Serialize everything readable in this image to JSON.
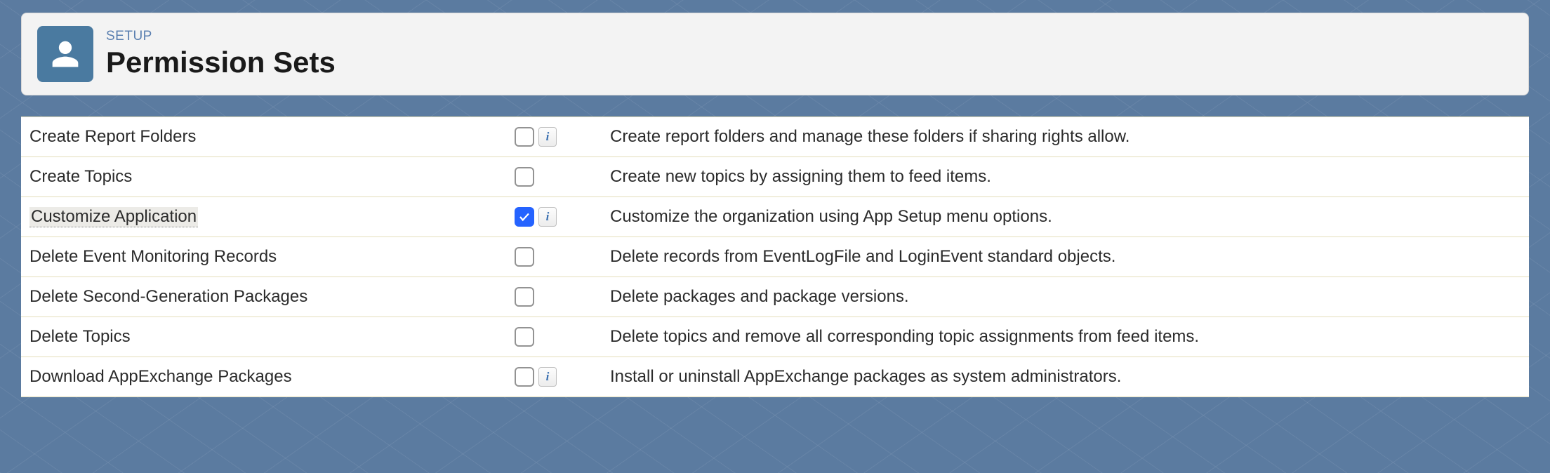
{
  "header": {
    "setup_label": "SETUP",
    "page_title": "Permission Sets"
  },
  "permissions": [
    {
      "name": "Create Report Folders",
      "checked": false,
      "has_info": true,
      "highlight": false,
      "description": "Create report folders and manage these folders if sharing rights allow."
    },
    {
      "name": "Create Topics",
      "checked": false,
      "has_info": false,
      "highlight": false,
      "description": "Create new topics by assigning them to feed items."
    },
    {
      "name": "Customize Application",
      "checked": true,
      "has_info": true,
      "highlight": true,
      "description": "Customize the organization using App Setup menu options."
    },
    {
      "name": "Delete Event Monitoring Records",
      "checked": false,
      "has_info": false,
      "highlight": false,
      "description": "Delete records from EventLogFile and LoginEvent standard objects."
    },
    {
      "name": "Delete Second-Generation Packages",
      "checked": false,
      "has_info": false,
      "highlight": false,
      "description": "Delete packages and package versions."
    },
    {
      "name": "Delete Topics",
      "checked": false,
      "has_info": false,
      "highlight": false,
      "description": "Delete topics and remove all corresponding topic assignments from feed items."
    },
    {
      "name": "Download AppExchange Packages",
      "checked": false,
      "has_info": true,
      "highlight": false,
      "description": "Install or uninstall AppExchange packages as system administrators."
    }
  ]
}
